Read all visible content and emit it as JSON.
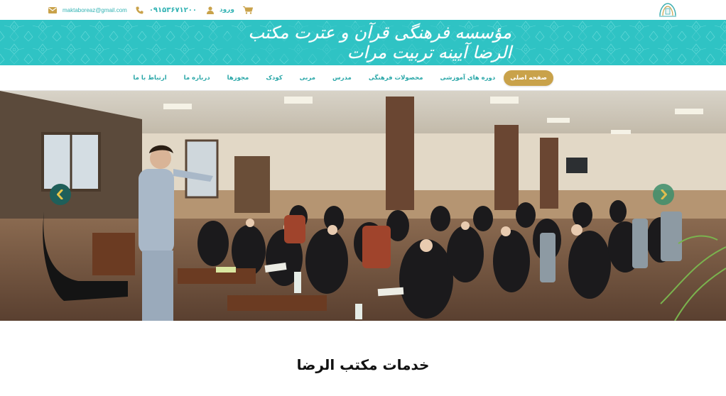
{
  "header": {
    "email": "maktaboreaz@gmail.com",
    "phone": "۰۹۱۵۳۶۷۱۲۰۰",
    "login_label": "ورود",
    "icons": [
      "mail-icon",
      "phone-icon",
      "user-icon",
      "cart-icon",
      "logo"
    ]
  },
  "banner": {
    "title": "مؤسسه فرهنگی قرآن و عترت مکتب الرضا آیینه تربیت مرات"
  },
  "nav": {
    "items": [
      {
        "label": "صفحه اصلی",
        "active": true
      },
      {
        "label": "دوره های آموزشی"
      },
      {
        "label": "محصولات فرهنگی"
      },
      {
        "label": "مدرس"
      },
      {
        "label": "مربی"
      },
      {
        "label": "کودک"
      },
      {
        "label": "مجوزها"
      },
      {
        "label": "درباره ما"
      },
      {
        "label": "ارتباط با ما"
      }
    ]
  },
  "hero": {
    "image": "classroom-photo",
    "prev_icon": "chevron-left-icon",
    "next_icon": "chevron-right-icon"
  },
  "services": {
    "title": "خدمات مکتب الرضا"
  },
  "colors": {
    "teal": "#2fc3c4",
    "teal_text": "#33b3b4",
    "gold": "#c9a24a",
    "arrow_dark": "#1f5f5a"
  }
}
